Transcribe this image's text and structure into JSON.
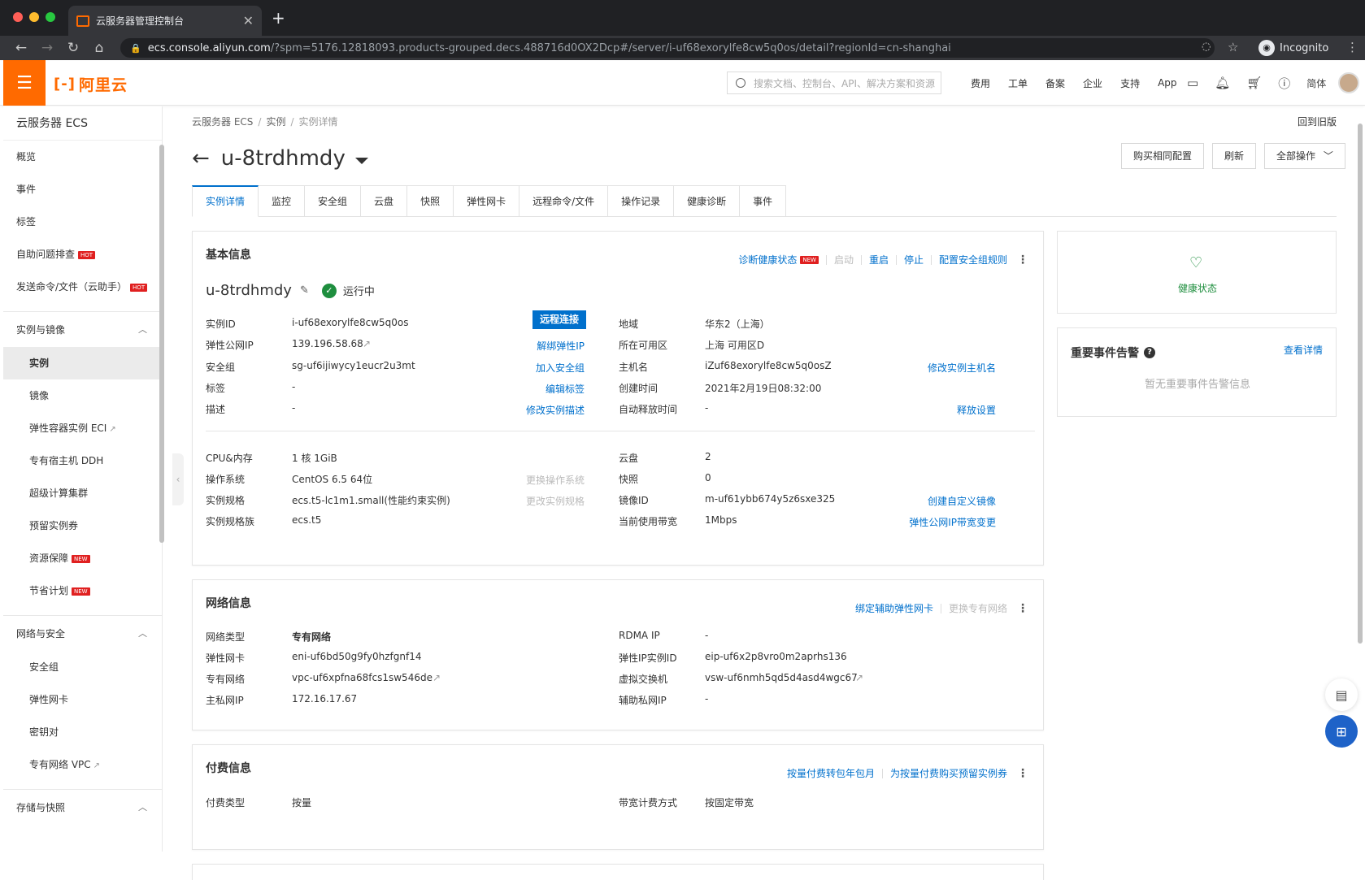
{
  "browser": {
    "tab_title": "云服务器管理控制台",
    "url_host": "ecs.console.aliyun.com",
    "url_path": "/?spm=5176.12818093.products-grouped.decs.488716d0OX2Dcp#/server/i-uf68exorylfe8cw5q0os/detail?regionId=cn-shanghai",
    "incognito": "Incognito"
  },
  "topnav": {
    "logo": "阿里云",
    "search_placeholder": "搜索文档、控制台、API、解决方案和资源",
    "links": [
      "费用",
      "工单",
      "备案",
      "企业",
      "支持",
      "App"
    ],
    "lang": "简体"
  },
  "sidebar": {
    "title": "云服务器 ECS",
    "top_items": [
      {
        "label": "概览"
      },
      {
        "label": "事件"
      },
      {
        "label": "标签"
      },
      {
        "label": "自助问题排查",
        "badge": "HOT"
      },
      {
        "label": "发送命令/文件（云助手）",
        "badge": "HOT"
      }
    ],
    "groups": [
      {
        "label": "实例与镜像",
        "items": [
          {
            "label": "实例",
            "active": true
          },
          {
            "label": "镜像"
          },
          {
            "label": "弹性容器实例 ECI",
            "ext": true
          },
          {
            "label": "专有宿主机 DDH"
          },
          {
            "label": "超级计算集群"
          },
          {
            "label": "预留实例券"
          },
          {
            "label": "资源保障",
            "badge": "NEW"
          },
          {
            "label": "节省计划",
            "badge": "NEW"
          }
        ]
      },
      {
        "label": "网络与安全",
        "items": [
          {
            "label": "安全组"
          },
          {
            "label": "弹性网卡"
          },
          {
            "label": "密钥对"
          },
          {
            "label": "专有网络 VPC",
            "ext": true
          }
        ]
      },
      {
        "label": "存储与快照",
        "items": []
      }
    ]
  },
  "breadcrumb": [
    "云服务器 ECS",
    "实例",
    "实例详情"
  ],
  "old_version": "回到旧版",
  "instance_name": "u-8trdhmdy",
  "header_buttons": [
    "购买相同配置",
    "刷新",
    "全部操作"
  ],
  "tabs": [
    "实例详情",
    "监控",
    "安全组",
    "云盘",
    "快照",
    "弹性网卡",
    "远程命令/文件",
    "操作记录",
    "健康诊断",
    "事件"
  ],
  "basic": {
    "title": "基本信息",
    "actions": {
      "diagnose": "诊断健康状态",
      "diagnose_badge": "NEW",
      "start": "启动",
      "restart": "重启",
      "stop": "停止",
      "sg_rule": "配置安全组规则"
    },
    "status": "运行中",
    "remote": "远程连接",
    "left": [
      {
        "label": "实例ID",
        "value": "i-uf68exorylfe8cw5q0os",
        "link": ""
      },
      {
        "label": "弹性公网IP",
        "value": "139.196.58.68",
        "link": "解绑弹性IP"
      },
      {
        "label": "安全组",
        "value": "sg-uf6ijiwycy1eucr2u3mt",
        "link": "加入安全组"
      },
      {
        "label": "标签",
        "value": "-",
        "link": "编辑标签"
      },
      {
        "label": "描述",
        "value": "-",
        "link": "修改实例描述"
      }
    ],
    "right": [
      {
        "label": "地域",
        "value": "华东2（上海）",
        "link": ""
      },
      {
        "label": "所在可用区",
        "value": "上海 可用区D",
        "link": ""
      },
      {
        "label": "主机名",
        "value": "iZuf68exorylfe8cw5q0osZ",
        "link": "修改实例主机名"
      },
      {
        "label": "创建时间",
        "value": "2021年2月19日08:32:00",
        "link": ""
      },
      {
        "label": "自动释放时间",
        "value": "-",
        "link": "释放设置"
      }
    ],
    "left2": [
      {
        "label": "CPU&内存",
        "value": "1 核 1GiB",
        "dlink": ""
      },
      {
        "label": "操作系统",
        "value": "CentOS 6.5 64位",
        "dlink": "更换操作系统"
      },
      {
        "label": "实例规格",
        "value": "ecs.t5-lc1m1.small(性能约束实例)",
        "dlink": "更改实例规格"
      },
      {
        "label": "实例规格族",
        "value": "ecs.t5",
        "dlink": ""
      }
    ],
    "right2": [
      {
        "label": "云盘",
        "value": "2",
        "link": ""
      },
      {
        "label": "快照",
        "value": "0",
        "link": ""
      },
      {
        "label": "镜像ID",
        "value": "m-uf61ybb674y5z6sxe325",
        "link": "创建自定义镜像"
      },
      {
        "label": "当前使用带宽",
        "value": "1Mbps",
        "link": "弹性公网IP带宽变更"
      }
    ]
  },
  "network": {
    "title": "网络信息",
    "actions": {
      "bind": "绑定辅助弹性网卡",
      "change": "更换专有网络"
    },
    "left": [
      {
        "label": "网络类型",
        "value": "专有网络"
      },
      {
        "label": "弹性网卡",
        "value": "eni-uf6bd50g9fy0hzfgnf14"
      },
      {
        "label": "专有网络",
        "value": "vpc-uf6xpfna68fcs1sw546de"
      },
      {
        "label": "主私网IP",
        "value": "172.16.17.67"
      }
    ],
    "right": [
      {
        "label": "RDMA IP",
        "value": "-"
      },
      {
        "label": "弹性IP实例ID",
        "value": "eip-uf6x2p8vro0m2aprhs136"
      },
      {
        "label": "虚拟交换机",
        "value": "vsw-uf6nmh5qd5d4asd4wgc67"
      },
      {
        "label": "辅助私网IP",
        "value": "-"
      }
    ]
  },
  "billing": {
    "title": "付费信息",
    "actions": {
      "convert": "按量付费转包年包月",
      "reserve": "为按量付费购买预留实例券"
    },
    "left": {
      "label": "付费类型",
      "value": "按量"
    },
    "right": {
      "label": "带宽计费方式",
      "value": "按固定带宽"
    }
  },
  "health": {
    "label": "健康状态"
  },
  "events": {
    "title": "重要事件告警",
    "detail": "查看详情",
    "empty": "暂无重要事件告警信息"
  },
  "colors": {
    "accent": "#ff6a00",
    "link": "#0070cc",
    "ok": "#1e8e3e"
  }
}
